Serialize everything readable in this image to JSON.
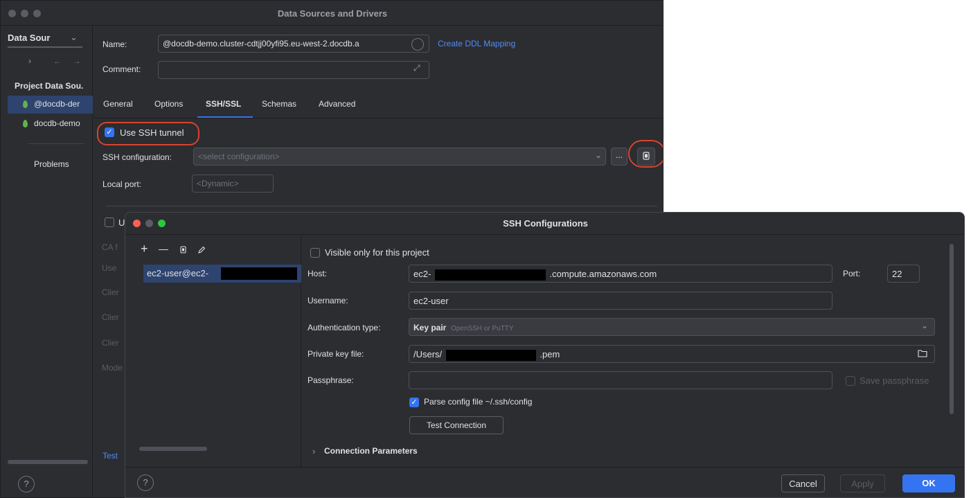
{
  "main_window": {
    "title": "Data Sources and Drivers",
    "sidebar": {
      "dropdown_label": "Data Sour",
      "section_title": "Project Data Sou.",
      "items": [
        {
          "label": "@docdb-der"
        },
        {
          "label": "docdb-demo"
        }
      ],
      "problems_label": "Problems"
    },
    "form": {
      "name_label": "Name:",
      "name_value": "@docdb-demo.cluster-cdtjj00yfi95.eu-west-2.docdb.a",
      "create_ddl_link": "Create DDL Mapping",
      "comment_label": "Comment:",
      "comment_value": ""
    },
    "tabs": [
      {
        "label": "General"
      },
      {
        "label": "Options"
      },
      {
        "label": "SSH/SSL"
      },
      {
        "label": "Schemas"
      },
      {
        "label": "Advanced"
      }
    ],
    "active_tab": "SSH/SSL",
    "ssh": {
      "use_tunnel_label": "Use SSH tunnel",
      "use_tunnel_checked": true,
      "config_label": "SSH configuration:",
      "config_placeholder": "<select configuration>",
      "ellipsis_label": "...",
      "local_port_label": "Local port:",
      "local_port_placeholder": "<Dynamic>"
    },
    "ssl_partial": {
      "checkbox_label": "U",
      "rows": [
        "CA f",
        "Use",
        "Clier",
        "Clier",
        "Clier",
        "Mode"
      ]
    },
    "test_label": "Test"
  },
  "dialog": {
    "title": "SSH Configurations",
    "toolbar": {
      "add": "+",
      "remove": "—"
    },
    "list_items": [
      {
        "label": "ec2-user@ec2-"
      }
    ],
    "visible_only_label": "Visible only for this project",
    "visible_only_checked": false,
    "host_label": "Host:",
    "host_prefix": "ec2-",
    "host_suffix": ".compute.amazonaws.com",
    "port_label": "Port:",
    "port_value": "22",
    "username_label": "Username:",
    "username_value": "ec2-user",
    "auth_label": "Authentication type:",
    "auth_value": "Key pair",
    "auth_hint": "OpenSSH or PuTTY",
    "key_label": "Private key file:",
    "key_prefix": "/Users/",
    "key_suffix": ".pem",
    "passphrase_label": "Passphrase:",
    "passphrase_value": "",
    "save_passphrase_label": "Save passphrase",
    "save_passphrase_checked": false,
    "parse_config_label": "Parse config file ~/.ssh/config",
    "parse_config_checked": true,
    "test_connection_label": "Test Connection",
    "connection_params_label": "Connection Parameters",
    "buttons": {
      "cancel": "Cancel",
      "apply": "Apply",
      "ok": "OK"
    },
    "help_label": "?"
  },
  "main_help_label": "?",
  "colors": {
    "accent": "#3574f0",
    "highlight_ring": "#d8432f",
    "mongo_leaf": "#5fb34a"
  }
}
